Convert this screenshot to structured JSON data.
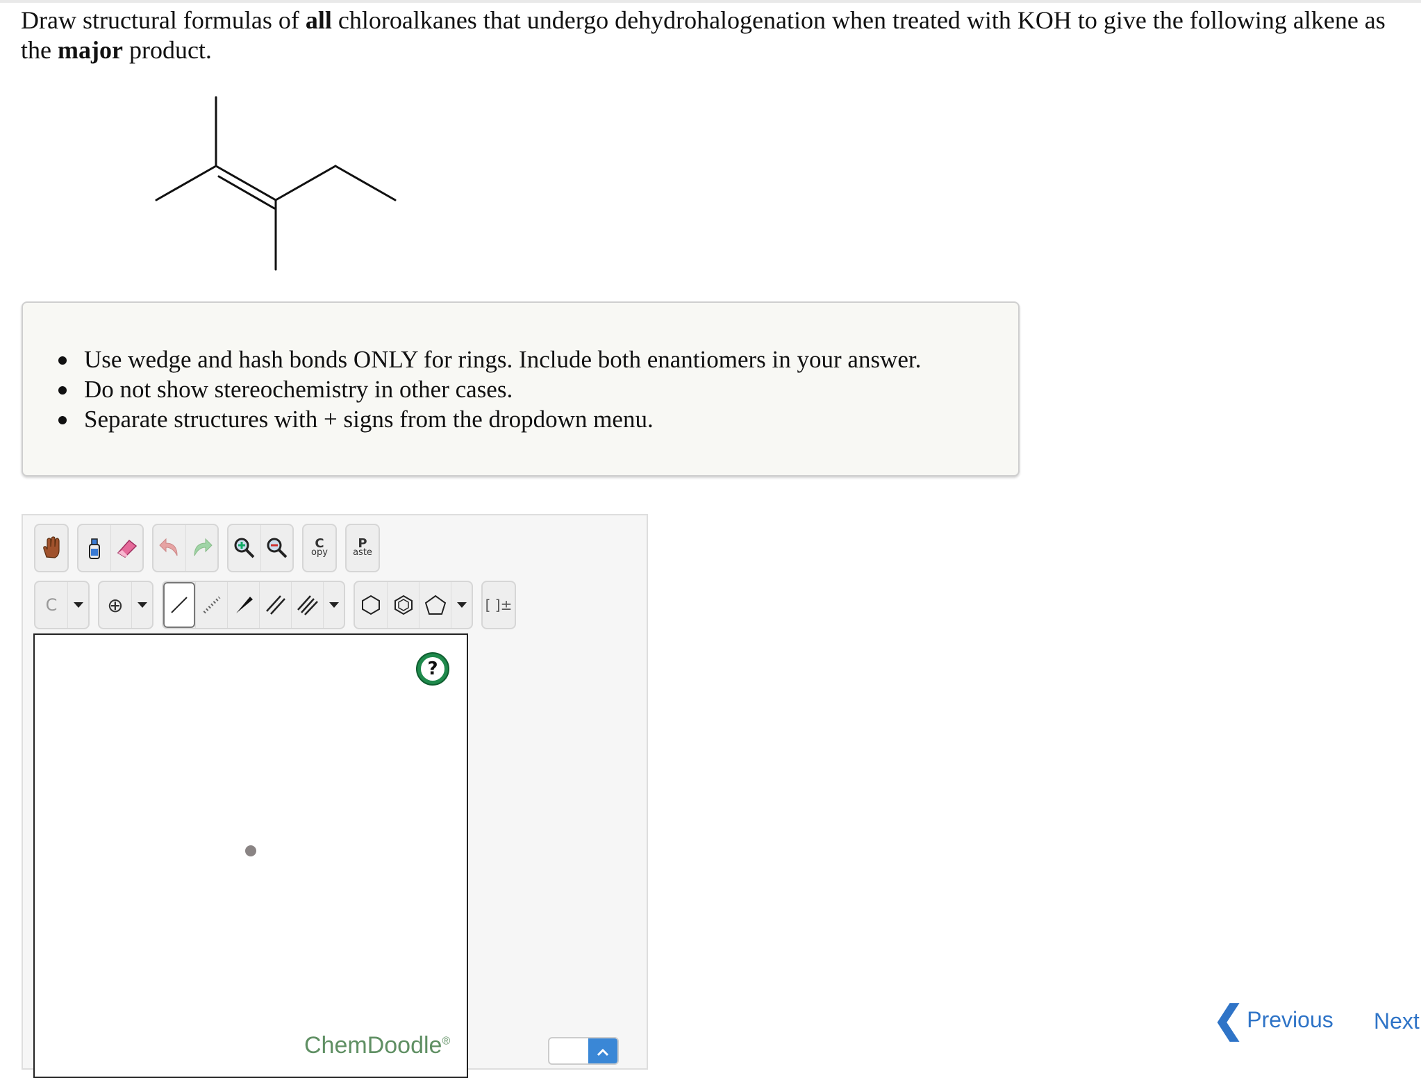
{
  "question": {
    "part1": "Draw structural formulas of ",
    "bold1": "all",
    "part2": " chloroalkanes that undergo dehydrohalogenation when treated with KOH to give the following alkene as the ",
    "bold2": "major",
    "part3": " product."
  },
  "instructions": [
    "Use wedge and hash bonds ONLY for rings. Include both enantiomers in your answer.",
    "Do not show stereochemistry in other cases.",
    "Separate structures with + signs from the dropdown menu."
  ],
  "toolbar": {
    "row1": [
      {
        "name": "hand-tool",
        "icon": "hand-icon"
      },
      {
        "name": "clear-tool",
        "icon": "bottle-icon"
      },
      {
        "name": "eraser-tool",
        "icon": "eraser-icon"
      },
      {
        "name": "undo-tool",
        "icon": "undo-icon"
      },
      {
        "name": "redo-tool",
        "icon": "redo-icon"
      },
      {
        "name": "zoom-in-tool",
        "icon": "zoom-in-icon"
      },
      {
        "name": "zoom-out-tool",
        "icon": "zoom-out-icon"
      }
    ],
    "copy_letter": "C",
    "copy_rest": "opy",
    "paste_letter": "P",
    "paste_rest": "aste",
    "atom_label": "C",
    "charge_label": "⊕",
    "bracket_label": "[ ]±"
  },
  "canvas": {
    "help_label": "?",
    "watermark": "ChemDoodle",
    "watermark_mark": "®"
  },
  "navigation": {
    "previous": "Previous",
    "next": "Next"
  },
  "colors": {
    "link": "#2f74c7",
    "help_green": "#1f8a4c",
    "watermark_green": "#5f8f63"
  }
}
